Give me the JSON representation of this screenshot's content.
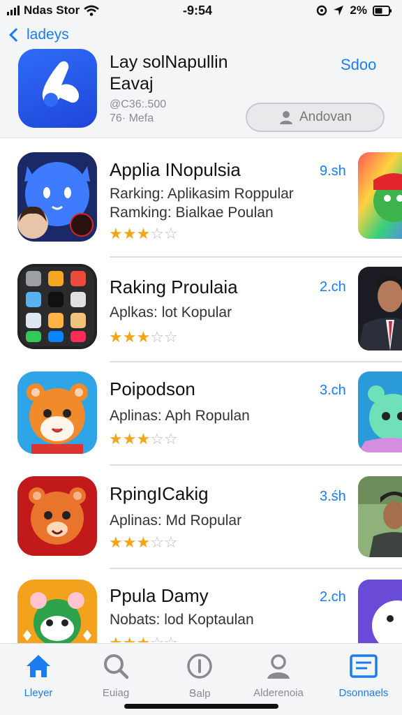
{
  "status_bar": {
    "carrier": "Ndas Stor",
    "time": "-9:54",
    "battery": "2%"
  },
  "header": {
    "back_label": "ladeys",
    "app_title_line1": "Lay solNapullin",
    "app_title_line2": "Eavaj",
    "meta_line1": "@C36:.500",
    "meta_line2": "76· Mefa",
    "link_label": "Sdoo",
    "action_button_label": "Andovan"
  },
  "apps": [
    {
      "title": "Applia INopulsia",
      "subtitles": [
        "Rarking:  Aplikasim Roppular",
        "Ramking: Bialkae Poulan"
      ],
      "size": "9.sh",
      "rating": 3,
      "rating_max": 5
    },
    {
      "title": "Raking Proulaia",
      "subtitles": [
        "Aplkas: lot Kopular"
      ],
      "size": "2.ch",
      "rating": 3,
      "rating_max": 5
    },
    {
      "title": "Poipodson",
      "subtitles": [
        "Aplinas: Aph Ropulan"
      ],
      "size": "3.ch",
      "rating": 3,
      "rating_max": 5
    },
    {
      "title": "RpingICakig",
      "subtitles": [
        "Aplinas: Md Ropular"
      ],
      "size": "3.śh",
      "rating": 3,
      "rating_max": 5
    },
    {
      "title": "Ppula Damy",
      "subtitles": [
        "Nobats: lod Koptaulan"
      ],
      "size": "2.ch",
      "rating": 3,
      "rating_max": 5
    }
  ],
  "tab_bar": {
    "tabs": [
      {
        "label": "Lleyer",
        "icon": "house-icon",
        "active": true
      },
      {
        "label": "Euiag",
        "icon": "search-icon",
        "active": false
      },
      {
        "label": "Ցalp",
        "icon": "circle-i-icon",
        "active": false
      },
      {
        "label": "Alderenoia",
        "icon": "person-icon",
        "active": false
      },
      {
        "label": "Dsonnaels",
        "icon": "card-icon",
        "active": true
      }
    ]
  },
  "colors": {
    "accent": "#1a7cf0",
    "star": "#f2a41a",
    "star_off": "#b9b9bd"
  }
}
